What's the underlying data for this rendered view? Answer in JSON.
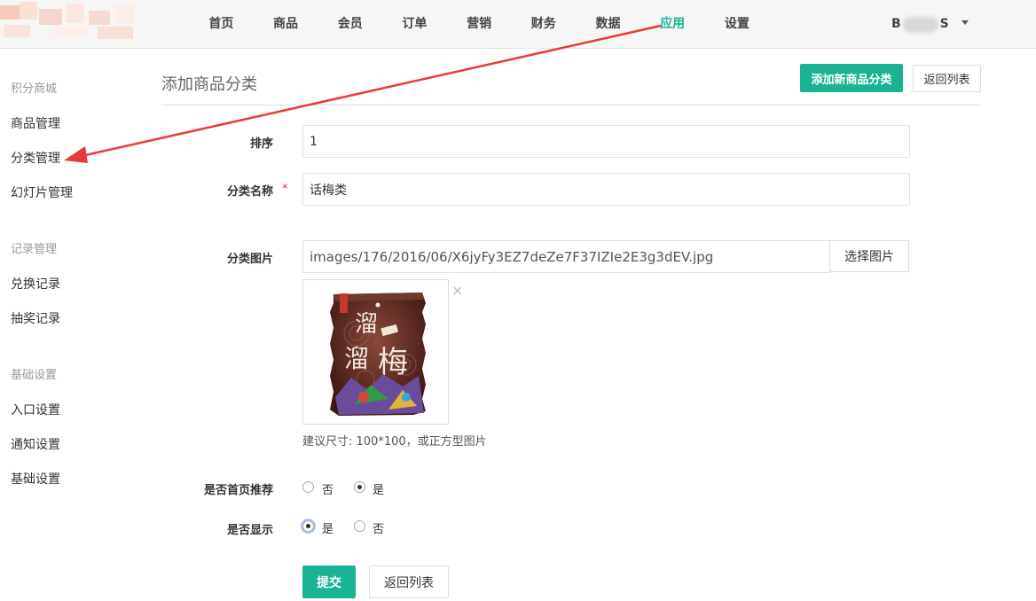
{
  "nav": {
    "items": [
      "首页",
      "商品",
      "会员",
      "订单",
      "营销",
      "财务",
      "数据",
      "应用",
      "设置"
    ],
    "active_label": "应用",
    "user_prefix": "B",
    "user_suffix": "S"
  },
  "sidebar": {
    "groups": [
      {
        "title": "积分商城",
        "items": [
          "商品管理",
          "分类管理",
          "幻灯片管理"
        ]
      },
      {
        "title": "记录管理",
        "items": [
          "兑换记录",
          "抽奖记录"
        ]
      },
      {
        "title": "基础设置",
        "items": [
          "入口设置",
          "通知设置",
          "基础设置"
        ]
      }
    ]
  },
  "page": {
    "title": "添加商品分类",
    "add_button": "添加新商品分类",
    "back_button": "返回列表"
  },
  "form": {
    "order_label": "排序",
    "order_value": "1",
    "name_label": "分类名称",
    "required_mark": "*",
    "name_value": "话梅类",
    "image_label": "分类图片",
    "image_path": "images/176/2016/06/X6jyFy3EZ7deZe7F37IZIe2E3g3dEV.jpg",
    "choose_image_button": "选择图片",
    "remove_icon": "×",
    "image_hint": "建议尺寸: 100*100，或正方型图片",
    "package_text": "溜溜梅",
    "recommend_label": "是否首页推荐",
    "recommend_options": [
      "否",
      "是"
    ],
    "recommend_selected": "是",
    "display_label": "是否显示",
    "display_options": [
      "是",
      "否"
    ],
    "display_selected": "是",
    "submit_button": "提交",
    "back_button": "返回列表"
  },
  "colors": {
    "accent": "#1ab394",
    "annotation_arrow": "#e83a3a",
    "required": "#e4393c"
  }
}
